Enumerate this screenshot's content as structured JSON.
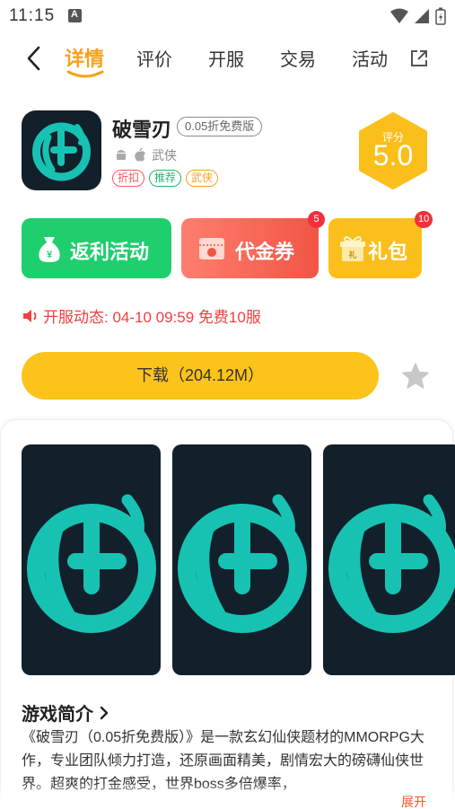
{
  "status_bar": {
    "time": "11:15"
  },
  "tabs": [
    {
      "label": "详情"
    },
    {
      "label": "评价"
    },
    {
      "label": "开服"
    },
    {
      "label": "交易"
    },
    {
      "label": "活动"
    }
  ],
  "app": {
    "name": "破雪刃",
    "version_badge": "0.05折免费版",
    "category": "武侠",
    "tags": [
      "折扣",
      "推荐",
      "武侠"
    ]
  },
  "rating": {
    "label": "评分",
    "value": "5.0"
  },
  "actions": {
    "rebate": {
      "label": "返利活动"
    },
    "voucher": {
      "label": "代金券",
      "count": "5"
    },
    "gift": {
      "label": "礼包",
      "count": "10"
    }
  },
  "server_news": {
    "text": "开服动态: 04-10 09:59  免费10服"
  },
  "download": {
    "label": "下载（204.12M）"
  },
  "intro": {
    "title": "游戏简介",
    "text": "《破雪刃（0.05折免费版）》是一款玄幻仙侠题材的MMORPG大作，专业团队倾力打造，还原画面精美，剧情宏大的磅礴仙侠世界。超爽的打金感受，世界boss多倍爆率，",
    "expand_label": "展开"
  },
  "colors": {
    "accent": "#f7a21b",
    "rebate_green": "#1fcf6e",
    "voucher_red": "#f15545",
    "gift_yellow": "#fbbf1c",
    "news_red": "#f04040",
    "download_yellow": "#fcc31a",
    "logo_teal": "#17c2b3",
    "logo_bg": "#12202b"
  }
}
